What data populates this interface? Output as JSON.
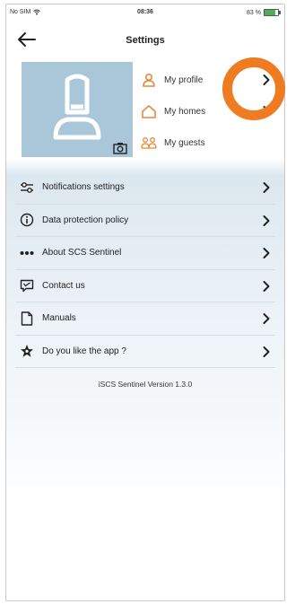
{
  "status_bar": {
    "carrier": "No SIM",
    "time": "08:36",
    "battery": "83 %",
    "battery_level": 0.83
  },
  "header": {
    "title": "Settings"
  },
  "profile_links": [
    {
      "label": "My profile",
      "icon": "person-icon"
    },
    {
      "label": "My homes",
      "icon": "home-icon"
    },
    {
      "label": "My guests",
      "icon": "guests-icon"
    }
  ],
  "menu": [
    {
      "label": "Notifications settings",
      "icon": "sliders-icon"
    },
    {
      "label": "Data protection policy",
      "icon": "info-icon"
    },
    {
      "label": "About SCS Sentinel",
      "icon": "dots-icon"
    },
    {
      "label": "Contact us",
      "icon": "chat-icon"
    },
    {
      "label": "Manuals",
      "icon": "document-icon"
    },
    {
      "label": "Do you like the app ?",
      "icon": "star-icon"
    }
  ],
  "version": "iSCS Sentinel Version 1.3.0",
  "colors": {
    "accent": "#f07c22",
    "avatar_bg": "#a9c7d8",
    "icon_orange": "#e8893a",
    "text": "#222222"
  }
}
